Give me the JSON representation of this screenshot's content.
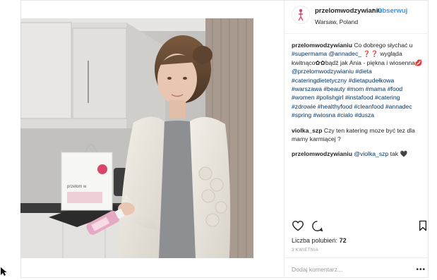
{
  "post": {
    "username": "przelomwodzywianiu",
    "separator": "•",
    "follow_label": "Obserwuj",
    "location": "Warsaw, Poland",
    "photo_alt": "",
    "bag_logo_text": "przelom w"
  },
  "comments": [
    {
      "user": "przelomwodzywianiu",
      "parts": [
        {
          "t": " Co dobrego słychać u ",
          "c": "text"
        },
        {
          "t": "#supermama",
          "c": "tag"
        },
        {
          "t": " ",
          "c": "text"
        },
        {
          "t": "@annadec_",
          "c": "mention"
        },
        {
          "t": " ❓❓ wygląda kwitnąco✿✿bądź jak Ania - piękna i wiosenna💋 ",
          "c": "text"
        },
        {
          "t": "@przelomwodzywianiu",
          "c": "mention"
        },
        {
          "t": " ",
          "c": "text"
        },
        {
          "t": "#dieta",
          "c": "tag"
        },
        {
          "t": " ",
          "c": "text"
        },
        {
          "t": "#cateringdietetyczny",
          "c": "tag"
        },
        {
          "t": " ",
          "c": "text"
        },
        {
          "t": "#dietapudełkowa",
          "c": "tag"
        },
        {
          "t": " ",
          "c": "text"
        },
        {
          "t": "#warszawa",
          "c": "tag"
        },
        {
          "t": " ",
          "c": "text"
        },
        {
          "t": "#beauty",
          "c": "tag"
        },
        {
          "t": " ",
          "c": "text"
        },
        {
          "t": "#mom",
          "c": "tag"
        },
        {
          "t": " ",
          "c": "text"
        },
        {
          "t": "#mama",
          "c": "tag"
        },
        {
          "t": " ",
          "c": "text"
        },
        {
          "t": "#food",
          "c": "tag"
        },
        {
          "t": " ",
          "c": "text"
        },
        {
          "t": "#women",
          "c": "tag"
        },
        {
          "t": " ",
          "c": "text"
        },
        {
          "t": "#polishgirl",
          "c": "tag"
        },
        {
          "t": " ",
          "c": "text"
        },
        {
          "t": "#instafood",
          "c": "tag"
        },
        {
          "t": " ",
          "c": "text"
        },
        {
          "t": "#catering",
          "c": "tag"
        },
        {
          "t": " ",
          "c": "text"
        },
        {
          "t": "#zdrowie",
          "c": "tag"
        },
        {
          "t": " ",
          "c": "text"
        },
        {
          "t": "#healthyfood",
          "c": "tag"
        },
        {
          "t": " ",
          "c": "text"
        },
        {
          "t": "#cleanfood",
          "c": "tag"
        },
        {
          "t": " ",
          "c": "text"
        },
        {
          "t": "#annadec",
          "c": "tag"
        },
        {
          "t": " ",
          "c": "text"
        },
        {
          "t": "#spring",
          "c": "tag"
        },
        {
          "t": " ",
          "c": "text"
        },
        {
          "t": "#wiosna",
          "c": "tag"
        },
        {
          "t": " ",
          "c": "text"
        },
        {
          "t": "#cialo",
          "c": "tag"
        },
        {
          "t": " ",
          "c": "text"
        },
        {
          "t": "#dusza",
          "c": "tag"
        }
      ]
    },
    {
      "user": "violka_szp",
      "parts": [
        {
          "t": " Czy ten katering moze być tez dla mamy karmiącej ?",
          "c": "text"
        }
      ]
    },
    {
      "user": "przelomwodzywianiu",
      "parts": [
        {
          "t": " ",
          "c": "text"
        },
        {
          "t": "@violka_szp",
          "c": "mention"
        },
        {
          "t": " tak 🖤",
          "c": "text"
        }
      ]
    }
  ],
  "actions": {
    "like_icon": "heart-outline-icon",
    "comment_icon": "comment-bubble-icon",
    "save_icon": "bookmark-icon"
  },
  "stats": {
    "likes_label": "Liczba polubień:",
    "likes_count": "72",
    "date": "3 KWIETNIA"
  },
  "add_comment": {
    "placeholder": "Dodaj komentarz...",
    "more_label": "•••"
  },
  "colors": {
    "link": "#003569",
    "follow": "#3897f0",
    "text": "#262626",
    "muted": "#999999",
    "border": "#efefef"
  }
}
